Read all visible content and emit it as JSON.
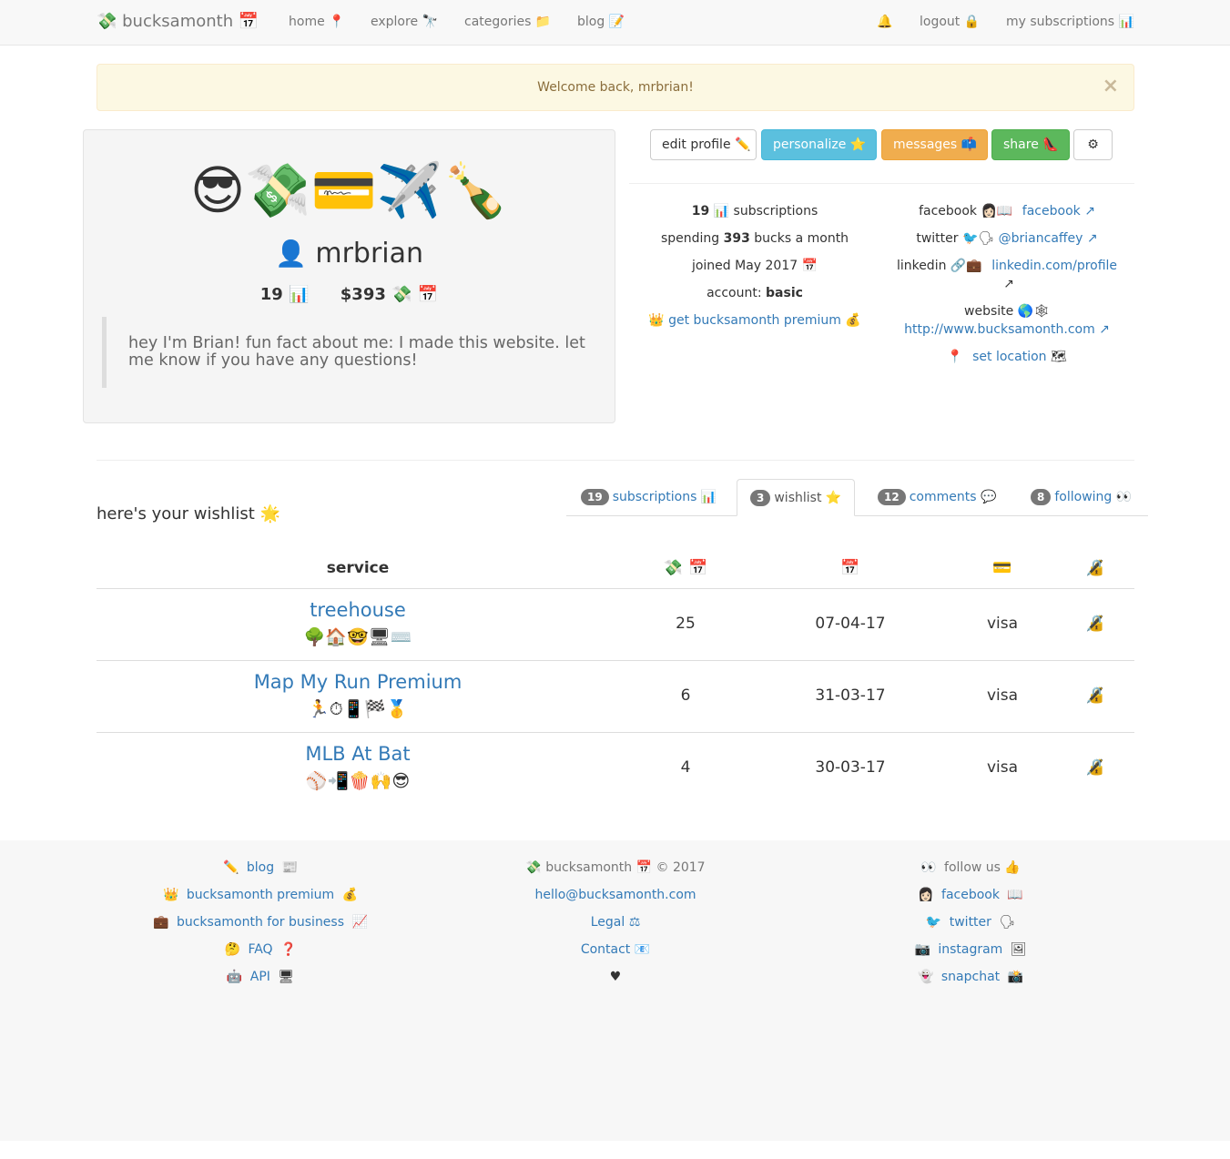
{
  "nav": {
    "brand": "💸 bucksamonth 📅",
    "home": "home 📍",
    "explore": "explore 🔭",
    "categories": "categories 📁",
    "blog": "blog 📝",
    "bell": "🔔",
    "logout": "logout 🔒",
    "subscriptions": "my subscriptions 📊"
  },
  "alert": {
    "text": "Welcome back, mrbrian!",
    "close": "×"
  },
  "profile": {
    "emojis": "😎💸💳✈️🍾",
    "avatar": "👤",
    "username": "mrbrian",
    "count": "19 📊",
    "spend": "$393 💸 📅",
    "bio": "hey I'm Brian! fun fact about me: I made this website. let me know if you have any questions!"
  },
  "buttons": {
    "edit": "edit profile ✏️",
    "personalize": "personalize ⭐",
    "messages": "messages 📫",
    "share": "share 👠",
    "settings": "⚙"
  },
  "info_left": {
    "subs_count": "19",
    "subs_label": "📊 subscriptions",
    "spending_pre": "spending ",
    "spending_value": "393",
    "spending_post": " bucks a month",
    "joined": "joined May 2017 📅",
    "account_label": "account: ",
    "account_value": "basic",
    "crown": "👑",
    "premium_link": "get bucksamonth premium",
    "premium_emoji": "💰"
  },
  "info_right": {
    "facebook_label": "facebook 👩🏻📖",
    "facebook_link": "facebook ↗",
    "twitter_label": "twitter 🐦🗣",
    "twitter_link": "@briancaffey ↗",
    "linkedin_label": "linkedin 🔗💼",
    "linkedin_link": "linkedin.com/profile",
    "linkedin_arrow": "↗",
    "website_label": "website 🌎🕸",
    "website_link": "http://www.bucksamonth.com ↗",
    "pin": "📍",
    "location_link": "set location",
    "location_emoji": "🗺"
  },
  "wishlist_heading": "here's your wishlist 🌟",
  "tabs": [
    {
      "count": "19",
      "label": "subscriptions 📊"
    },
    {
      "count": "3",
      "label": "wishlist ⭐"
    },
    {
      "count": "12",
      "label": "comments 💬"
    },
    {
      "count": "8",
      "label": "following 👀"
    }
  ],
  "table": {
    "headers": {
      "service": "service",
      "price": "💸 📅",
      "date": "📅",
      "card": "💳",
      "lock": "🔏"
    },
    "rows": [
      {
        "name": "treehouse",
        "emojis": "🌳🏠🤓🖥⌨️",
        "price": "25",
        "date": "07-04-17",
        "card": "visa",
        "lock": "🔏"
      },
      {
        "name": "Map My Run Premium",
        "emojis": "🏃⏱📱🏁🥇",
        "price": "6",
        "date": "31-03-17",
        "card": "visa",
        "lock": "🔏"
      },
      {
        "name": "MLB At Bat",
        "emojis": "⚾📲🍿🙌😎",
        "price": "4",
        "date": "30-03-17",
        "card": "visa",
        "lock": "🔏"
      }
    ]
  },
  "footer": {
    "col1": [
      {
        "icon": "✏️",
        "link": "blog",
        "emoji": "📰"
      },
      {
        "icon": "👑",
        "link": "bucksamonth premium",
        "emoji": "💰"
      },
      {
        "icon": "💼",
        "link": "bucksamonth for business",
        "emoji": "📈"
      },
      {
        "icon": "🤔",
        "link": "FAQ",
        "emoji": "❓"
      },
      {
        "icon": "🤖",
        "link": "API",
        "emoji": "🖥"
      }
    ],
    "col2": {
      "brand": "💸 bucksamonth 📅 © 2017",
      "email": "hello@bucksamonth.com",
      "legal": "Legal ⚖",
      "contact": "Contact 📧",
      "heart": "♥"
    },
    "col3": [
      {
        "icon": "👀",
        "text": "follow us 👍"
      },
      {
        "icon": "👩🏻",
        "link": "facebook",
        "emoji": "📖"
      },
      {
        "icon": "🐦",
        "link": "twitter",
        "emoji": "🗣"
      },
      {
        "icon": "📷",
        "link": "instagram",
        "emoji": "🖼"
      },
      {
        "icon": "👻",
        "link": "snapchat",
        "emoji": "📸"
      }
    ]
  }
}
